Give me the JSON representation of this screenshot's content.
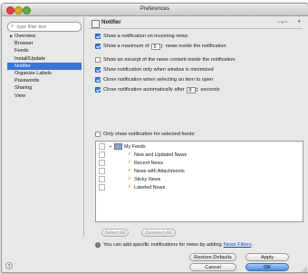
{
  "window": {
    "title": "Preferences"
  },
  "sidebar": {
    "filter_placeholder": "type filter text",
    "items": [
      {
        "label": "Overview",
        "expandable": true
      },
      {
        "label": "Browser"
      },
      {
        "label": "Feeds"
      },
      {
        "label": "Install/Update"
      },
      {
        "label": "Notifier",
        "selected": true
      },
      {
        "label": "Organize Labels"
      },
      {
        "label": "Passwords"
      },
      {
        "label": "Sharing"
      },
      {
        "label": "View"
      }
    ]
  },
  "header": {
    "title": "Notifier",
    "icon": "notifier-page-icon"
  },
  "options": {
    "show_on_incoming": {
      "label": "Show a notification on incoming news",
      "checked": true
    },
    "max_news": {
      "label_before": "Show a maximum of",
      "value": "5",
      "label_after": "news inside the notification",
      "checked": true
    },
    "show_excerpt": {
      "label": "Show an excerpt of the news content inside the notification",
      "checked": false
    },
    "only_minimized": {
      "label": "Show notification only when window is minimized",
      "checked": true
    },
    "close_on_open": {
      "label": "Close notification when selecting an item to open",
      "checked": true
    },
    "auto_close": {
      "label_before": "Close notification automatically after",
      "value": "8",
      "label_after": "seconds",
      "checked": true
    },
    "only_selected_feeds": {
      "label": "Only show notification for selected feeds:",
      "checked": false
    }
  },
  "feeds_tree": {
    "root": "My Feeds",
    "children": [
      "New and Updated News",
      "Recent News",
      "News with Attachments",
      "Sticky News",
      "Labeled News"
    ]
  },
  "buttons": {
    "select_all": "Select All",
    "deselect_all": "Deselect All",
    "restore_defaults": "Restore Defaults",
    "apply": "Apply",
    "cancel": "Cancel",
    "ok": "OK"
  },
  "info": {
    "text": "You can add specific notifications for news by adding",
    "link": "News Filters",
    "suffix": "."
  },
  "colors": {
    "selection": "#3875d7",
    "link": "#1a4fc4",
    "checkbox_checked": "#3b7bd9"
  }
}
